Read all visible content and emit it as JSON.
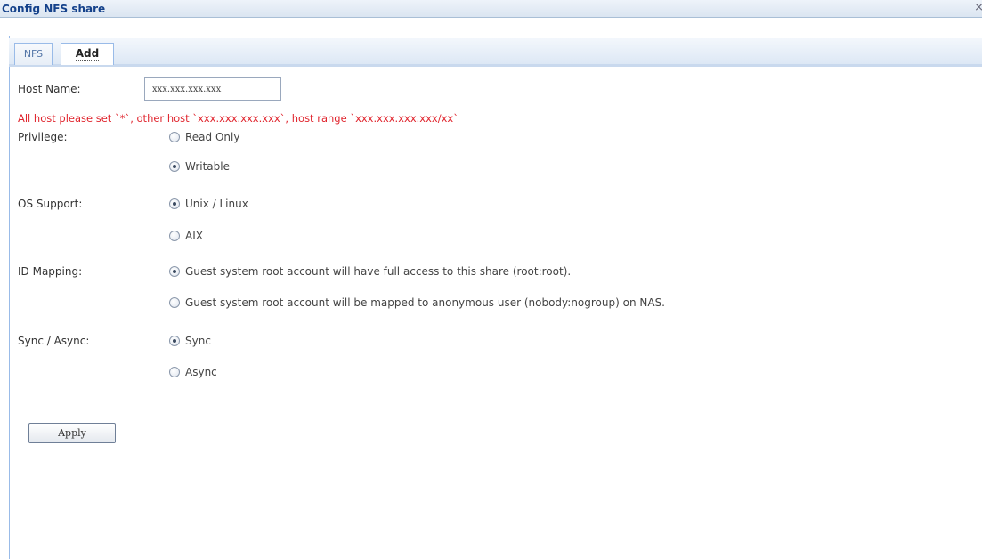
{
  "window": {
    "title": "Config NFS share",
    "close_label": "×"
  },
  "tabs": [
    {
      "label": "NFS"
    },
    {
      "label": "Add"
    }
  ],
  "form": {
    "host_name": {
      "label": "Host Name:",
      "value": "xxx.xxx.xxx.xxx"
    },
    "hint": "All host please set `*`, other host `xxx.xxx.xxx.xxx`, host range `xxx.xxx.xxx.xxx/xx`",
    "privilege": {
      "label": "Privilege:",
      "options": [
        {
          "label": "Read Only",
          "checked": false
        },
        {
          "label": "Writable",
          "checked": true
        }
      ]
    },
    "os_support": {
      "label": "OS Support:",
      "options": [
        {
          "label": "Unix / Linux",
          "checked": true
        },
        {
          "label": "AIX",
          "checked": false
        }
      ]
    },
    "id_mapping": {
      "label": "ID Mapping:",
      "options": [
        {
          "label": "Guest system root account will have full access to this share (root:root).",
          "checked": true
        },
        {
          "label": "Guest system root account will be mapped to anonymous user (nobody:nogroup) on NAS.",
          "checked": false
        }
      ]
    },
    "sync": {
      "label": "Sync / Async:",
      "options": [
        {
          "label": "Sync",
          "checked": true
        },
        {
          "label": "Async",
          "checked": false
        }
      ]
    },
    "apply_label": "Apply"
  },
  "colors": {
    "title": "#15428b",
    "hint": "#e0242d",
    "border": "#99bbe8"
  }
}
